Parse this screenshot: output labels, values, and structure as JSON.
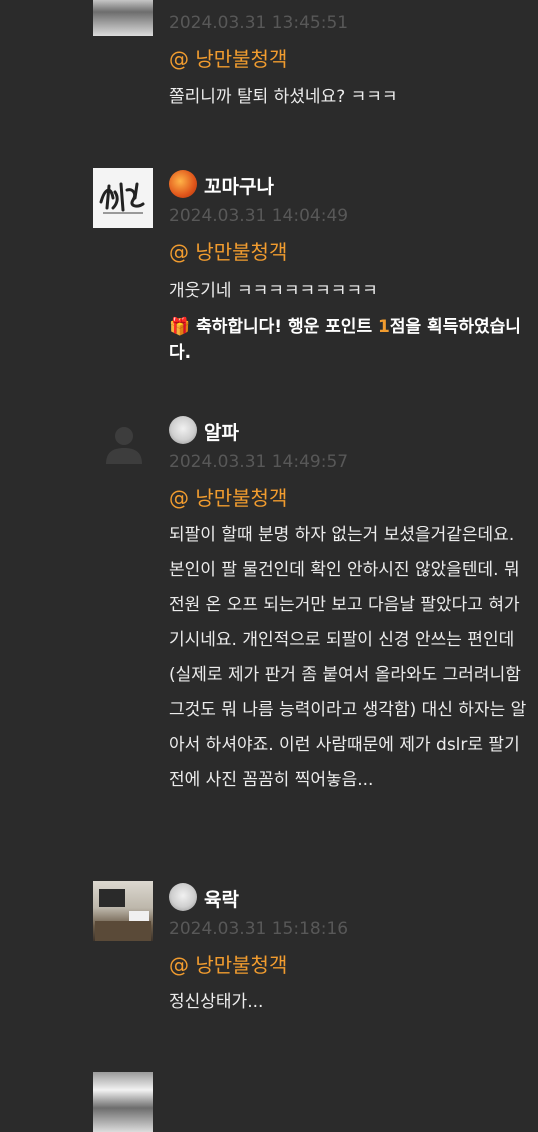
{
  "comments": [
    {
      "nickname": "",
      "date": "2024.03.31 13:45:51",
      "mention": "@ 낭만불청객",
      "text": "쫄리니까 탈퇴 하셨네요? ㅋㅋㅋ"
    },
    {
      "nickname": "꼬마구나",
      "date": "2024.03.31 14:04:49",
      "mention": "@ 낭만불청객",
      "text": "개웃기네 ㅋㅋㅋㅋㅋㅋㅋㅋㅋ",
      "reward": {
        "icon": "🎁",
        "prefix": "축하합니다! 행운 포인트 ",
        "points": "1",
        "suffix": "점을 획득하였습니다."
      }
    },
    {
      "nickname": "알파",
      "date": "2024.03.31 14:49:57",
      "mention": "@ 낭만불청객",
      "lines": [
        "되팔이 할때 분명 하자 없는거 보셨을거같은데요.",
        "본인이 팔 물건인데 확인 안하시진 않았을텐데. 뭐",
        "전원 온 오프 되는거만 보고 다음날 팔았다고 혀가",
        "기시네요. 개인적으로 되팔이 신경 안쓰는 편인데",
        "(실제로 제가 판거 좀 붙여서 올라와도 그러려니함",
        "그것도 뭐 나름 능력이라고 생각함) 대신 하자는 알",
        "아서 하셔야죠. 이런 사람때문에 제가 dslr로 팔기",
        "전에 사진 꼼꼼히 찍어놓음..."
      ]
    },
    {
      "nickname": "육락",
      "date": "2024.03.31 15:18:16",
      "mention": "@ 낭만불청객",
      "text": "정신상태가..."
    }
  ]
}
